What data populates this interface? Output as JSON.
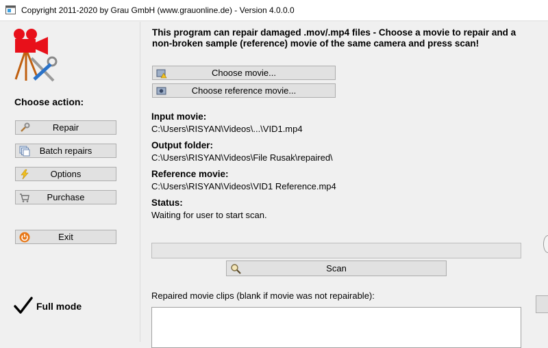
{
  "window": {
    "title": "Copyright 2011-2020 by Grau GmbH (www.grauonline.de) - Version 4.0.0.0"
  },
  "sidebar": {
    "heading": "Choose action:",
    "buttons": [
      {
        "label": "Repair",
        "icon": "wrench-icon"
      },
      {
        "label": "Batch repairs",
        "icon": "stack-icon"
      },
      {
        "label": "Options",
        "icon": "lightning-icon"
      },
      {
        "label": "Purchase",
        "icon": "cart-icon"
      },
      {
        "label": "Exit",
        "icon": "power-icon"
      }
    ],
    "mode": "Full mode"
  },
  "main": {
    "intro": "This program can repair damaged .mov/.mp4 files - Choose a movie to repair and a non-broken sample (reference) movie of the same camera and press scan!",
    "choose_movie": "Choose movie...",
    "choose_reference": "Choose reference movie...",
    "input_label": "Input movie:",
    "input_value": "C:\\Users\\RISYAN\\Videos\\...\\VID1.mp4",
    "output_label": "Output folder:",
    "output_value": "C:\\Users\\RISYAN\\Videos\\File Rusak\\repaired\\",
    "reference_label": "Reference movie:",
    "reference_value": "C:\\Users\\RISYAN\\Videos\\VID1 Reference.mp4",
    "status_label": "Status:",
    "status_value": "Waiting for user to start scan.",
    "progress": 0,
    "scan": "Scan",
    "clips_label": "Repaired movie clips (blank if movie was not repairable):"
  },
  "colors": {
    "window_bg": "#f0f0f0",
    "button_bg": "#e1e1e1",
    "logo_red": "#e8101a"
  }
}
